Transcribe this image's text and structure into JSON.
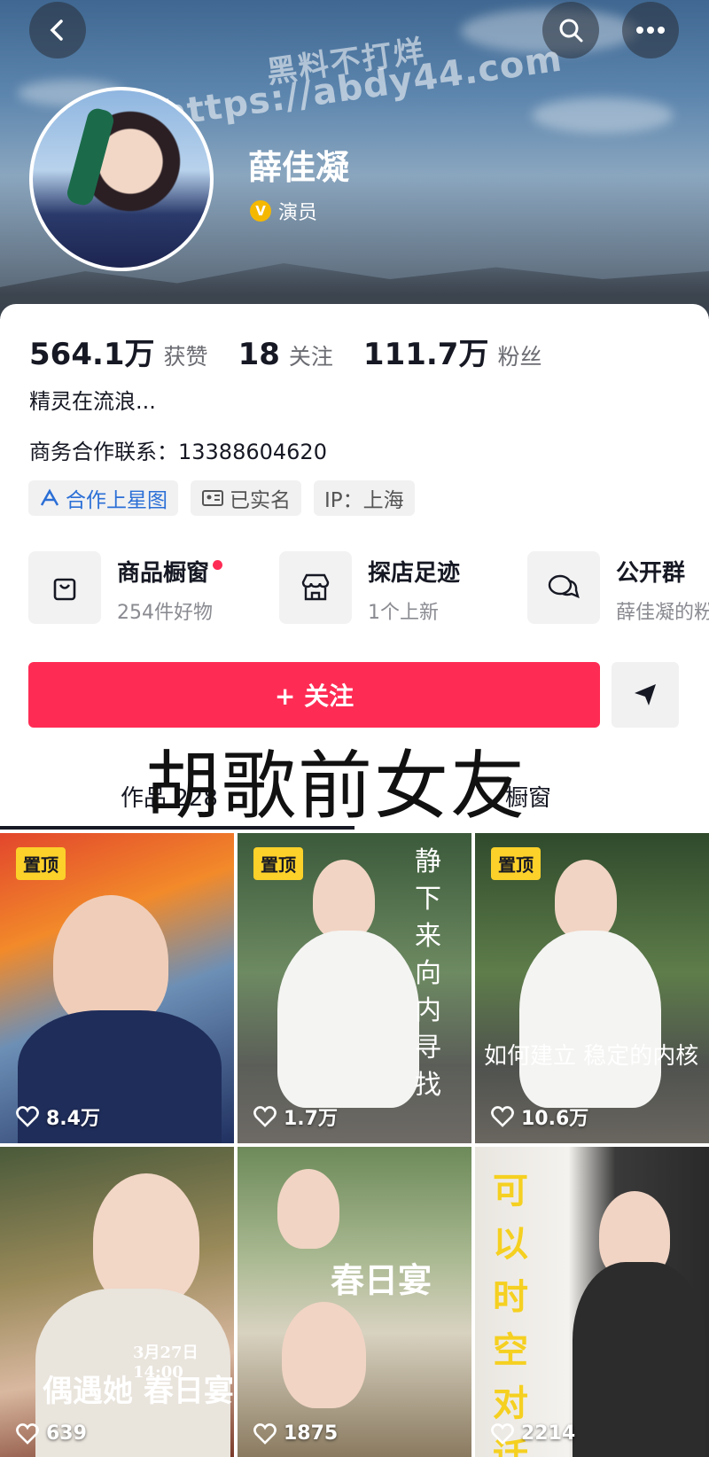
{
  "header": {
    "watermark_line1": "黑料不打烊",
    "watermark_line2": "https://abdy44.com",
    "profile_name": "薛佳凝",
    "verified_badge": "V",
    "verified_label": "演员"
  },
  "stats": [
    {
      "value": "564.1万",
      "label": "获赞"
    },
    {
      "value": "18",
      "label": "关注"
    },
    {
      "value": "111.7万",
      "label": "粉丝"
    }
  ],
  "bio": {
    "line1": "精灵在流浪...",
    "line2": "商务合作联系：13388604620"
  },
  "tags": [
    {
      "label": "合作上星图",
      "icon": "star-map-icon"
    },
    {
      "label": "已实名",
      "icon": "id-card-icon"
    },
    {
      "label": "IP：上海",
      "icon": ""
    }
  ],
  "shortcuts": [
    {
      "title": "商品橱窗",
      "subtitle": "254件好物",
      "icon": "shopping-bag-icon"
    },
    {
      "title": "探店足迹",
      "subtitle": "1个上新",
      "icon": "store-icon"
    },
    {
      "title": "公开群",
      "subtitle": "薛佳凝的粉",
      "icon": "chat-group-icon"
    }
  ],
  "follow_button": "+ 关注",
  "overlay_caption": "胡歌前女友",
  "tabs": [
    {
      "label": "作品 228"
    },
    {
      "label": "橱窗"
    }
  ],
  "videos": [
    {
      "pinned": "置顶",
      "likes": "8.4万",
      "caption": ""
    },
    {
      "pinned": "置顶",
      "likes": "1.7万",
      "caption": "静下来 向内寻找"
    },
    {
      "pinned": "置顶",
      "likes": "10.6万",
      "caption": "如何建立 稳定的内核"
    },
    {
      "pinned": "",
      "likes": "639",
      "caption": "偶遇她 春日宴",
      "date": "3月27日14:00"
    },
    {
      "pinned": "",
      "likes": "1875",
      "caption": "春日宴"
    },
    {
      "pinned": "",
      "likes": "2214",
      "caption": "可以 时空对话"
    }
  ],
  "colors": {
    "accent": "#fe2c55",
    "pin": "#fcd12a",
    "verified": "#f5b800"
  }
}
